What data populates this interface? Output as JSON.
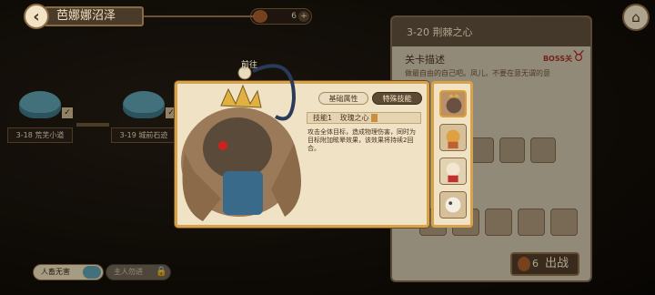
{
  "header": {
    "back_icon": "back-arrow-icon",
    "area_title": "芭娜娜沼泽",
    "coin_count": "6",
    "home_icon": "home-icon"
  },
  "map": {
    "nodes": [
      {
        "label": "3-18 荒芜小道"
      },
      {
        "label": "3-19 城前石迹"
      }
    ]
  },
  "level_panel": {
    "title": "3-20 荆棘之心",
    "desc_title": "关卡描述",
    "boss_tag": "BOSS关",
    "description": "做最自由的自己吧。凤儿，不要在意无谓的意"
  },
  "popup": {
    "go_label": "前往",
    "tabs": [
      {
        "label": "基础属性",
        "active": false
      },
      {
        "label": "特殊技能",
        "active": true
      }
    ],
    "skill": {
      "index": "技能1",
      "name": "玫瑰之心",
      "description": "攻击全体目标，造成物理伤害，同时为目标附加眩晕效果，该效果将持续2回合。"
    }
  },
  "fight": {
    "count": "6",
    "label": "出战"
  },
  "bottom": {
    "harmless_label": "人畜无害",
    "follow_label": "主人勿进"
  },
  "colors": {
    "accent_gold": "#d8a24a",
    "panel_cream": "#f0e3c5",
    "dark_brown": "#5d4a35"
  }
}
